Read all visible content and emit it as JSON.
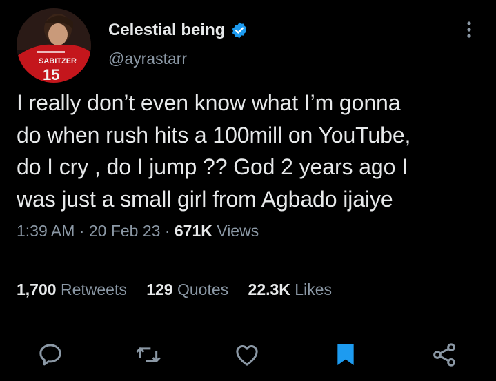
{
  "author": {
    "display_name": "Celestial being",
    "handle": "@ayrastarr",
    "verified_icon": "verified-badge-icon",
    "avatar_jersey_text": "SABITZER",
    "avatar_jersey_number": "15"
  },
  "tweet": {
    "text_lines": [
      "I really don’t even know what I’m gonna",
      "do when rush hits a 100mill on YouTube,",
      "do I cry , do I jump ?? God 2 years ago I",
      "was just a small girl from Agbado ijaiye"
    ]
  },
  "meta": {
    "time": "1:39 AM",
    "separator": " · ",
    "date": "20 Feb 23",
    "views_count": "671K",
    "views_label": "Views"
  },
  "stats": {
    "retweets_count": "1,700",
    "retweets_label": "Retweets",
    "quotes_count": "129",
    "quotes_label": "Quotes",
    "likes_count": "22.3K",
    "likes_label": "Likes"
  },
  "actions": {
    "icons": [
      "reply-icon",
      "retweet-icon",
      "like-icon",
      "bookmark-icon",
      "share-icon"
    ],
    "bookmark_active": true
  },
  "colors": {
    "background": "#000000",
    "text_primary": "#e7e9ea",
    "text_secondary": "#8b98a5",
    "accent": "#1d9bf0",
    "divider": "#2f3336",
    "avatar_red": "#c4161c"
  }
}
